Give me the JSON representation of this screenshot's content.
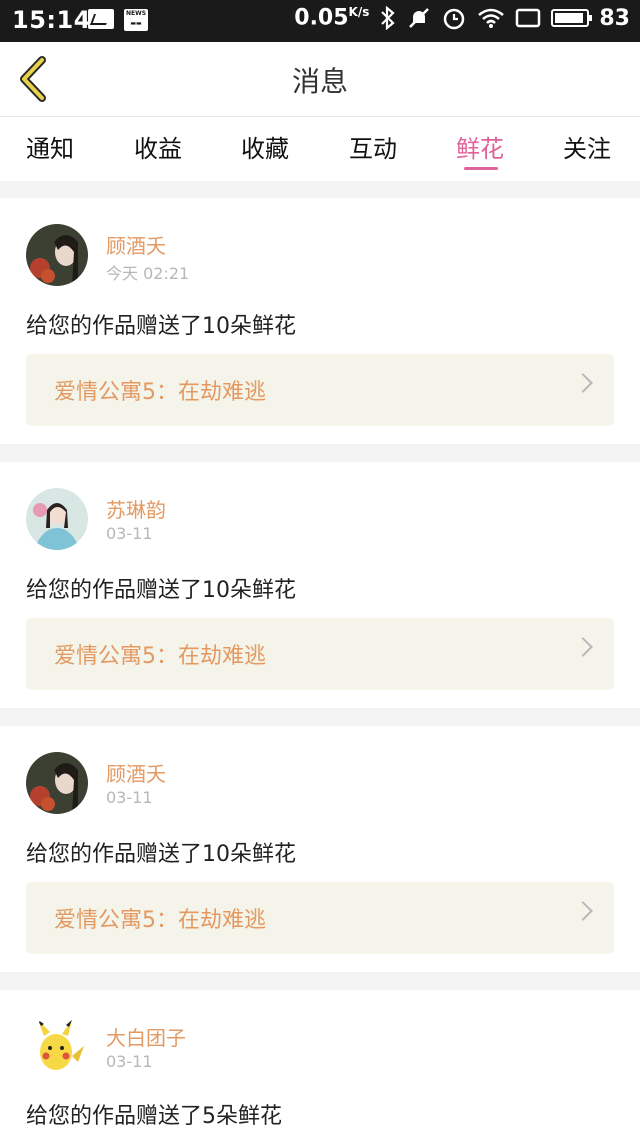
{
  "status_bar": {
    "time": "15:14",
    "speed": "0.05",
    "speed_unit": "K/s",
    "battery": "83",
    "icons": [
      "image-icon",
      "news-icon",
      "bluetooth-icon",
      "mute-icon",
      "alarm-icon",
      "wifi-icon",
      "screen-icon",
      "battery-icon"
    ]
  },
  "header": {
    "title": "消息"
  },
  "tabs": [
    {
      "label": "通知"
    },
    {
      "label": "收益"
    },
    {
      "label": "收藏"
    },
    {
      "label": "互动"
    },
    {
      "label": "鲜花",
      "active": true
    },
    {
      "label": "关注"
    }
  ],
  "items": [
    {
      "name": "顾酒夭",
      "time": "今天 02:21",
      "message": "给您的作品赠送了10朵鲜花",
      "work": "爱情公寓5：在劫难逃"
    },
    {
      "name": "苏琳韵",
      "time": "03-11",
      "message": "给您的作品赠送了10朵鲜花",
      "work": "爱情公寓5：在劫难逃"
    },
    {
      "name": "顾酒夭",
      "time": "03-11",
      "message": "给您的作品赠送了10朵鲜花",
      "work": "爱情公寓5：在劫难逃"
    },
    {
      "name": "大白团子",
      "time": "03-11",
      "message": "给您的作品赠送了5朵鲜花"
    }
  ],
  "colors": {
    "accent": "#e0629a",
    "name": "#e39a62",
    "back_icon": "#e8d24a"
  }
}
